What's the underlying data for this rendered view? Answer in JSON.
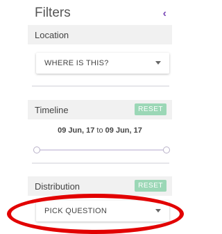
{
  "filters": {
    "title": "Filters",
    "collapse_icon": "chevron-left-icon"
  },
  "location": {
    "label": "Location",
    "select_value": "WHERE IS THIS?"
  },
  "timeline": {
    "label": "Timeline",
    "reset_label": "RESET",
    "start": "09 Jun, 17",
    "connector": "to",
    "end": "09 Jun, 17"
  },
  "distribution": {
    "label": "Distribution",
    "reset_label": "RESET",
    "select_value": "PICK QUESTION"
  },
  "colors": {
    "accent": "#7b4bb7",
    "reset_bg": "#9bd7b6",
    "highlight": "#e20000"
  }
}
